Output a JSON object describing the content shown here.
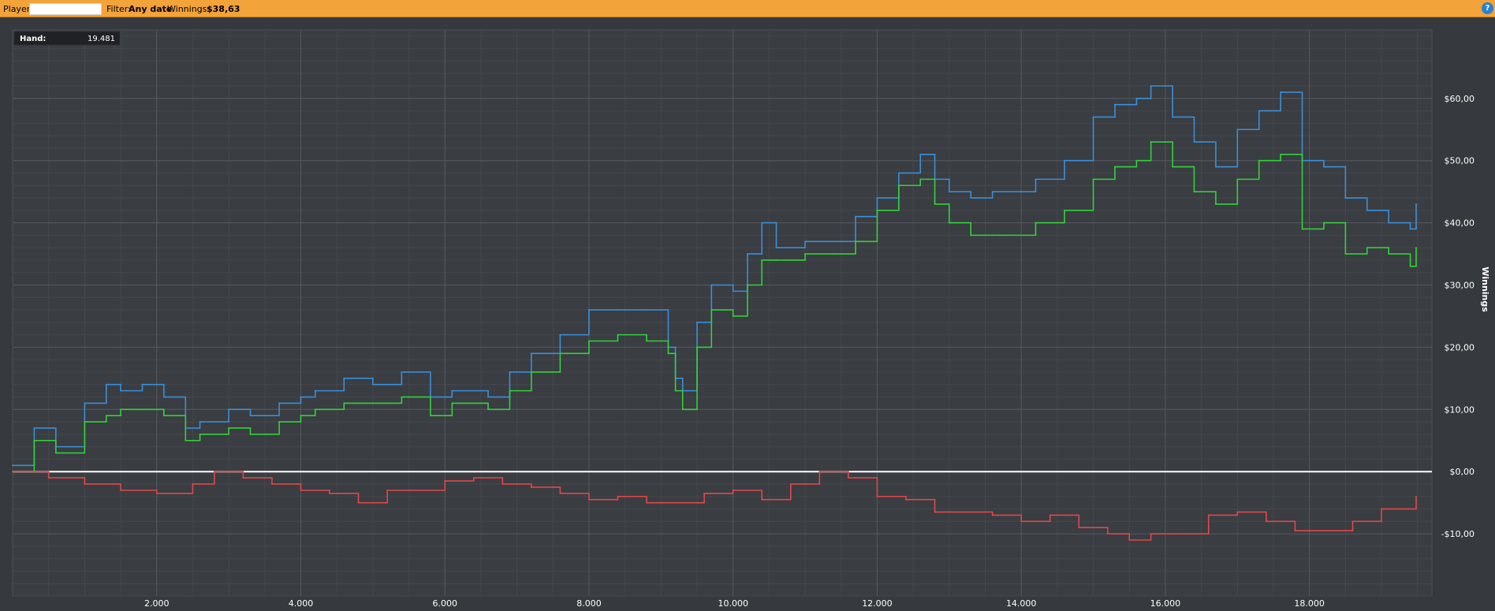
{
  "topbar": {
    "player_label": "Player",
    "filter_label": "Filter:",
    "filter_value": "Any date",
    "winnings_label": "Winnings:",
    "winnings_value": "$38,63",
    "help_glyph": "?"
  },
  "tooltip": {
    "label": "Hand:",
    "value": "19.481"
  },
  "chart_data": {
    "type": "line",
    "xlim": [
      0,
      19700
    ],
    "ylim": [
      -20,
      71
    ],
    "x_ticks": [
      2000,
      4000,
      6000,
      8000,
      10000,
      12000,
      14000,
      16000,
      18000
    ],
    "x_tick_labels": [
      "2.000",
      "4.000",
      "6.000",
      "8.000",
      "10.000",
      "12.000",
      "14.000",
      "16.000",
      "18.000"
    ],
    "y_ticks": [
      -10,
      0,
      10,
      20,
      30,
      40,
      50,
      60
    ],
    "y_tick_labels": [
      "-$10,00",
      "$0,00",
      "$10,00",
      "$20,00",
      "$30,00",
      "$40,00",
      "$50,00",
      "$60,00"
    ],
    "ylabel": "Winnings",
    "zero_line": true,
    "grid": true,
    "series": [
      {
        "color": "#3a8fd8",
        "x": [
          0,
          300,
          600,
          1000,
          1300,
          1500,
          1800,
          2100,
          2400,
          2600,
          3000,
          3300,
          3700,
          4000,
          4200,
          4600,
          5000,
          5400,
          5800,
          6100,
          6600,
          6900,
          7200,
          7600,
          8000,
          8400,
          8800,
          9100,
          9200,
          9300,
          9500,
          9700,
          10000,
          10200,
          10400,
          10600,
          11000,
          11400,
          11700,
          12000,
          12300,
          12600,
          12800,
          13000,
          13300,
          13600,
          13900,
          14200,
          14600,
          15000,
          15300,
          15600,
          15800,
          16100,
          16400,
          16700,
          17000,
          17300,
          17600,
          17900,
          18200,
          18500,
          18800,
          19100,
          19400,
          19481
        ],
        "y": [
          1,
          7,
          4,
          11,
          14,
          13,
          14,
          12,
          7,
          8,
          10,
          9,
          11,
          12,
          13,
          15,
          14,
          16,
          12,
          13,
          12,
          16,
          19,
          22,
          26,
          26,
          26,
          20,
          15,
          13,
          24,
          30,
          29,
          35,
          40,
          36,
          37,
          37,
          41,
          44,
          48,
          51,
          47,
          45,
          44,
          45,
          45,
          47,
          50,
          57,
          59,
          60,
          62,
          57,
          53,
          49,
          55,
          58,
          61,
          50,
          49,
          44,
          42,
          40,
          39,
          43
        ]
      },
      {
        "color": "#32d23a",
        "x": [
          0,
          300,
          600,
          1000,
          1300,
          1500,
          1800,
          2100,
          2400,
          2600,
          3000,
          3300,
          3700,
          4000,
          4200,
          4600,
          5000,
          5400,
          5800,
          6100,
          6600,
          6900,
          7200,
          7600,
          8000,
          8400,
          8800,
          9100,
          9200,
          9300,
          9500,
          9700,
          10000,
          10200,
          10400,
          10600,
          11000,
          11400,
          11700,
          12000,
          12300,
          12600,
          12800,
          13000,
          13300,
          13600,
          13900,
          14200,
          14600,
          15000,
          15300,
          15600,
          15800,
          16100,
          16400,
          16700,
          17000,
          17300,
          17600,
          17900,
          18200,
          18500,
          18800,
          19100,
          19400,
          19481
        ],
        "y": [
          0,
          5,
          3,
          8,
          9,
          10,
          10,
          9,
          5,
          6,
          7,
          6,
          8,
          9,
          10,
          11,
          11,
          12,
          9,
          11,
          10,
          13,
          16,
          19,
          21,
          22,
          21,
          19,
          13,
          10,
          20,
          26,
          25,
          30,
          34,
          34,
          35,
          35,
          37,
          42,
          46,
          47,
          43,
          40,
          38,
          38,
          38,
          40,
          42,
          47,
          49,
          50,
          53,
          49,
          45,
          43,
          47,
          50,
          51,
          39,
          40,
          35,
          36,
          35,
          33,
          36
        ]
      },
      {
        "color": "#e04848",
        "x": [
          0,
          500,
          1000,
          1500,
          2000,
          2500,
          2800,
          3200,
          3600,
          4000,
          4400,
          4800,
          5200,
          5600,
          6000,
          6400,
          6800,
          7200,
          7600,
          8000,
          8400,
          8800,
          9200,
          9600,
          10000,
          10400,
          10800,
          11200,
          11600,
          12000,
          12400,
          12800,
          13200,
          13600,
          14000,
          14400,
          14800,
          15200,
          15500,
          15800,
          16200,
          16600,
          17000,
          17400,
          17800,
          18200,
          18600,
          19000,
          19481
        ],
        "y": [
          0,
          -1,
          -2,
          -3,
          -3.5,
          -2,
          0,
          -1,
          -2,
          -3,
          -3.5,
          -5,
          -3,
          -3,
          -1.5,
          -1,
          -2,
          -2.5,
          -3.5,
          -4.5,
          -4,
          -5,
          -5,
          -3.5,
          -3,
          -4.5,
          -2,
          0,
          -1,
          -4,
          -4.5,
          -6.5,
          -6.5,
          -7,
          -8,
          -7,
          -9,
          -10,
          -11,
          -10,
          -10,
          -7,
          -6.5,
          -8,
          -9.5,
          -9.5,
          -8,
          -6,
          -4
        ]
      }
    ]
  }
}
